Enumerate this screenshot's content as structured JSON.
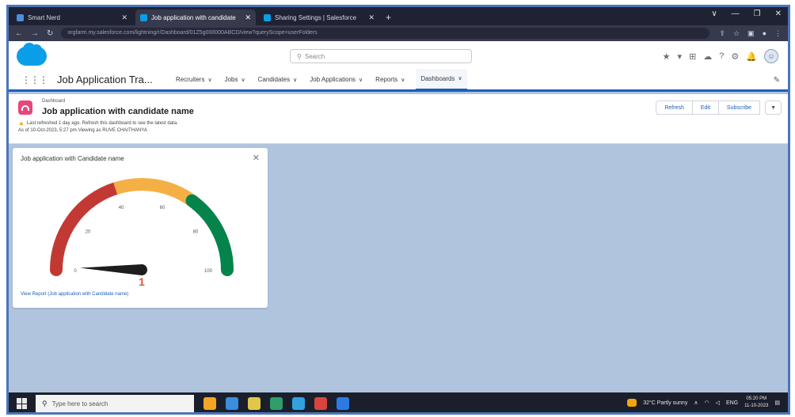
{
  "browser": {
    "tabs": [
      {
        "label": "Smart Nerd",
        "icon_color": "#4a90e2",
        "active": false
      },
      {
        "label": "Job application with candidate",
        "icon_color": "#0b9ee8",
        "active": true
      },
      {
        "label": "Sharing Settings | Salesforce",
        "icon_color": "#0b9ee8",
        "active": false
      }
    ],
    "new_tab_label": "+",
    "url": "orgfarm.my.salesforce.com/lightning/r/Dashboard/01Z5g000000ABCD/view?queryScope=userFolders",
    "window_controls": [
      "∨",
      "—",
      "❐",
      "✕"
    ]
  },
  "salesforce": {
    "search_placeholder": "Search",
    "app_name": "Job Application Tra...",
    "nav_items": [
      {
        "label": "Recruiters",
        "active": false
      },
      {
        "label": "Jobs",
        "active": false
      },
      {
        "label": "Candidates",
        "active": false
      },
      {
        "label": "Job Applications",
        "active": false
      },
      {
        "label": "Reports",
        "active": false
      },
      {
        "label": "Dashboards",
        "active": true
      }
    ],
    "header_icons": [
      "★",
      "▾",
      "⊞",
      "☁",
      "?",
      "⚙",
      "🔔"
    ]
  },
  "dashboard": {
    "type_label": "Dashboard",
    "title": "Job application with candidate name",
    "refresh_notice": "Last refreshed 1 day ago. Refresh this dashboard to see the latest data.",
    "as_of": "As of 10-Oct-2023, 5:27 pm·Viewing as RUVE CHAITHANYA",
    "buttons": {
      "refresh": "Refresh",
      "edit": "Edit",
      "subscribe": "Subscribe",
      "menu": "▼"
    }
  },
  "widget": {
    "title": "Job application with Candidate name",
    "close_label": "✕",
    "view_report": "View Report (Job application with Candidate name)",
    "gauge": {
      "min": 0,
      "max": 100,
      "value": 1,
      "value_label": "1",
      "tick_labels": [
        "0",
        "20",
        "40",
        "60",
        "80",
        "100"
      ],
      "bands": [
        {
          "from": 0,
          "to": 40,
          "color": "#c23934"
        },
        {
          "from": 40,
          "to": 70,
          "color": "#f4b045"
        },
        {
          "from": 70,
          "to": 100,
          "color": "#04844b"
        }
      ],
      "needle_color": "#1d1d1d",
      "value_color": "#e4572e"
    }
  },
  "taskbar": {
    "search_placeholder": "Type here to search",
    "weather": "32°C  Partly sunny",
    "tray_text": "ENG",
    "time": "05:20 PM",
    "date": "11-10-2023",
    "apps": [
      "#f5a623",
      "#3b8ddd",
      "#e2c84a",
      "#2f9e6a",
      "#31a2e0",
      "#d9453d",
      "#2c7be5"
    ]
  }
}
